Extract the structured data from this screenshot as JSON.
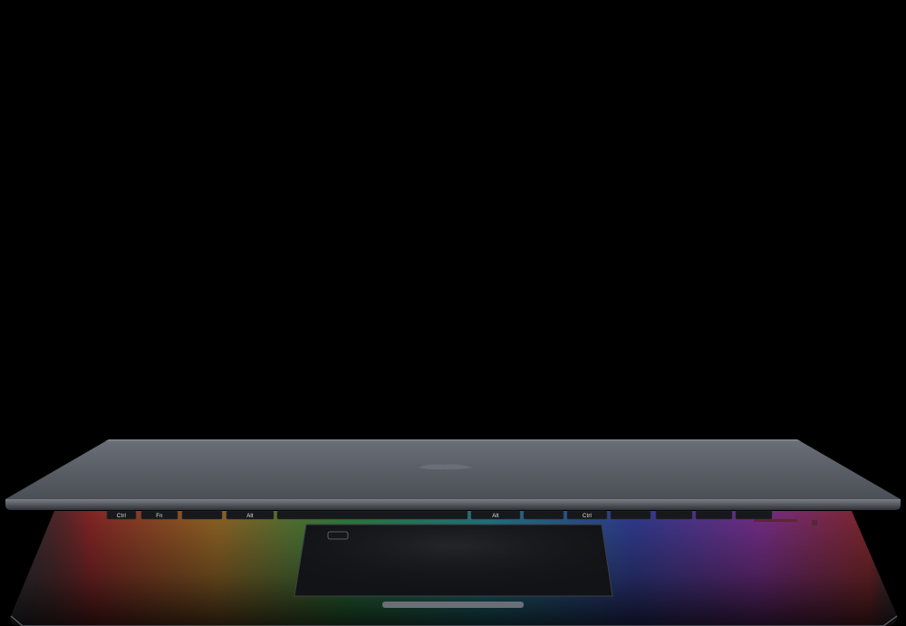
{
  "scene": {
    "background_color": "#000000",
    "subject": "laptop-partially-open",
    "lid_color": "#5b5f66",
    "base_color": "#3a3d43"
  },
  "keyboard": {
    "keys": [
      {
        "label": "Ctrl"
      },
      {
        "label": "Fn"
      },
      {
        "label": ""
      },
      {
        "label": "Alt"
      },
      {
        "label": ""
      },
      {
        "label": "Alt"
      },
      {
        "label": ""
      },
      {
        "label": "Ctrl"
      },
      {
        "label": ""
      },
      {
        "label": ""
      },
      {
        "label": ""
      },
      {
        "label": ""
      }
    ],
    "backlight_colors": [
      "#d0231f",
      "#e9a019",
      "#37d046",
      "#17c6d8",
      "#3b4de0",
      "#b22fc8",
      "#d0231f"
    ]
  }
}
